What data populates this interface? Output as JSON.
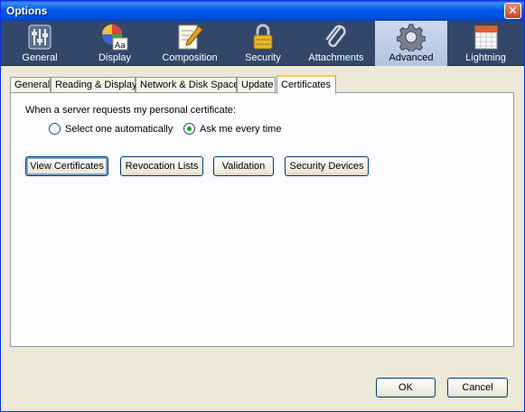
{
  "window": {
    "title": "Options",
    "close_label": "✕"
  },
  "toolbar": {
    "items": [
      {
        "label": "General",
        "icon": "general-sliders-icon",
        "selected": false
      },
      {
        "label": "Display",
        "icon": "display-color-icon",
        "selected": false
      },
      {
        "label": "Composition",
        "icon": "composition-pen-icon",
        "selected": false
      },
      {
        "label": "Security",
        "icon": "lock-icon",
        "selected": false
      },
      {
        "label": "Attachments",
        "icon": "paperclip-icon",
        "selected": false
      },
      {
        "label": "Advanced",
        "icon": "gear-icon",
        "selected": true
      },
      {
        "label": "Lightning",
        "icon": "calendar-icon",
        "selected": false
      }
    ]
  },
  "tabs": [
    {
      "label": "General",
      "active": false
    },
    {
      "label": "Reading & Display",
      "active": false
    },
    {
      "label": "Network & Disk Space",
      "active": false
    },
    {
      "label": "Update",
      "active": false
    },
    {
      "label": "Certificates",
      "active": true
    }
  ],
  "certificates": {
    "prompt": "When a server requests my personal certificate:",
    "options": [
      {
        "label": "Select one automatically",
        "checked": false
      },
      {
        "label": "Ask me every time",
        "checked": true
      }
    ],
    "buttons": {
      "view": "View Certificates",
      "revocation": "Revocation Lists",
      "validation": "Validation",
      "security_devices": "Security Devices"
    }
  },
  "footer": {
    "ok": "OK",
    "cancel": "Cancel"
  },
  "colors": {
    "titlebar": "#0058e6",
    "toolbar": "#32476a",
    "tab_highlight": "#ffc83c"
  }
}
